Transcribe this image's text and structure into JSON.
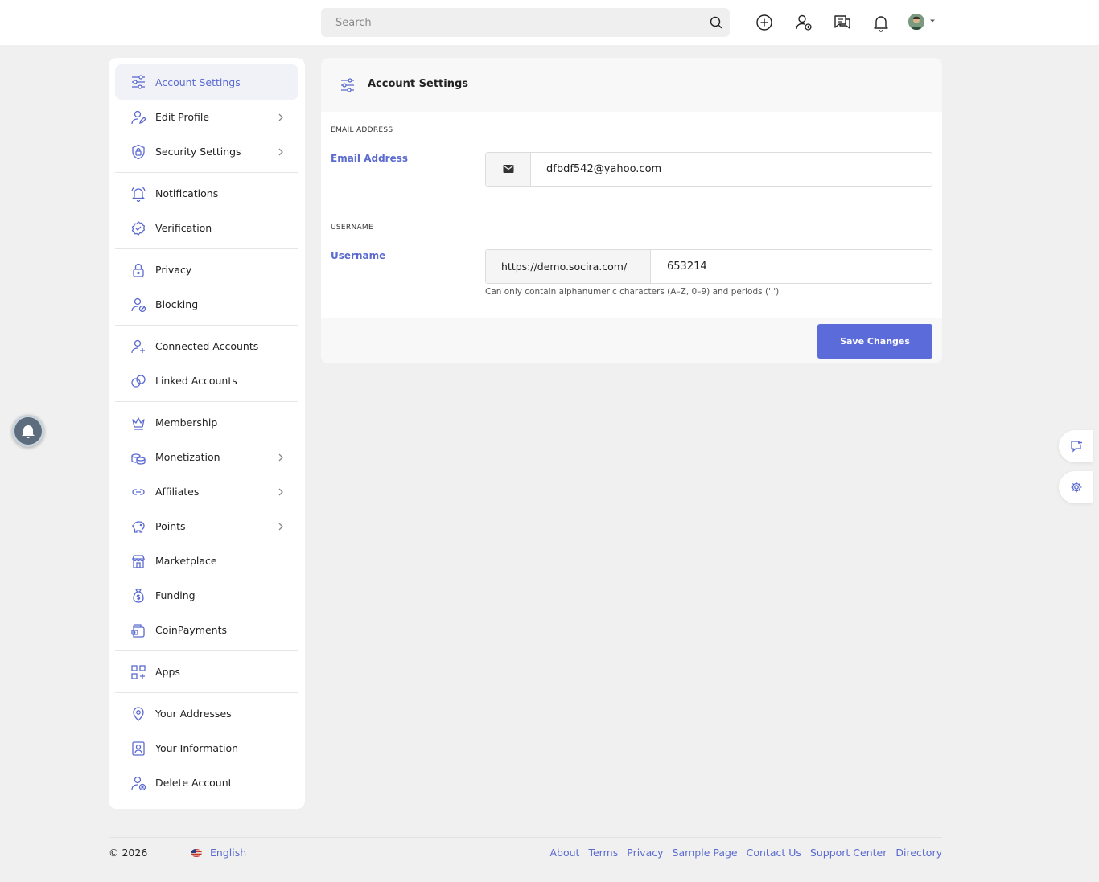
{
  "header": {
    "search_placeholder": "Search",
    "icons": [
      "add-circle-icon",
      "add-user-icon",
      "messages-icon",
      "bell-icon",
      "avatar"
    ]
  },
  "sidebar": {
    "items": [
      {
        "label": "Account Settings",
        "icon": "sliders-icon",
        "active": true
      },
      {
        "label": "Edit Profile",
        "icon": "user-edit-icon",
        "chevron": true
      },
      {
        "label": "Security Settings",
        "icon": "shield-lock-icon",
        "chevron": true
      },
      {
        "label": "Notifications",
        "icon": "bell-icon"
      },
      {
        "label": "Verification",
        "icon": "badge-check-icon"
      },
      {
        "label": "Privacy",
        "icon": "lock-icon"
      },
      {
        "label": "Blocking",
        "icon": "user-block-icon"
      },
      {
        "label": "Connected Accounts",
        "icon": "user-plus-icon"
      },
      {
        "label": "Linked Accounts",
        "icon": "link-icon"
      },
      {
        "label": "Membership",
        "icon": "crown-icon"
      },
      {
        "label": "Monetization",
        "icon": "coins-icon",
        "chevron": true
      },
      {
        "label": "Affiliates",
        "icon": "chain-icon",
        "chevron": true
      },
      {
        "label": "Points",
        "icon": "piggy-bank-icon",
        "chevron": true
      },
      {
        "label": "Marketplace",
        "icon": "store-icon"
      },
      {
        "label": "Funding",
        "icon": "money-bag-icon"
      },
      {
        "label": "CoinPayments",
        "icon": "wallet-icon"
      },
      {
        "label": "Apps",
        "icon": "apps-icon"
      },
      {
        "label": "Your Addresses",
        "icon": "map-pin-icon"
      },
      {
        "label": "Your Information",
        "icon": "id-card-icon"
      },
      {
        "label": "Delete Account",
        "icon": "user-delete-icon"
      }
    ]
  },
  "main": {
    "title": "Account Settings",
    "email_section": {
      "caption": "EMAIL ADDRESS",
      "label": "Email Address",
      "value": "dfbdf542@yahoo.com"
    },
    "username_section": {
      "caption": "USERNAME",
      "label": "Username",
      "prefix": "https://demo.socira.com/",
      "value": "653214",
      "help": "Can only contain alphanumeric characters (A–Z, 0–9) and periods ('.')"
    },
    "save_label": "Save Changes"
  },
  "footer": {
    "copyright": "© 2026",
    "language": "English",
    "links": [
      "About",
      "Terms",
      "Privacy",
      "Sample Page",
      "Contact Us",
      "Support Center",
      "Directory"
    ]
  },
  "colors": {
    "accent": "#5a6acf",
    "button": "#5b6bd9",
    "background": "#f0f0f0"
  }
}
